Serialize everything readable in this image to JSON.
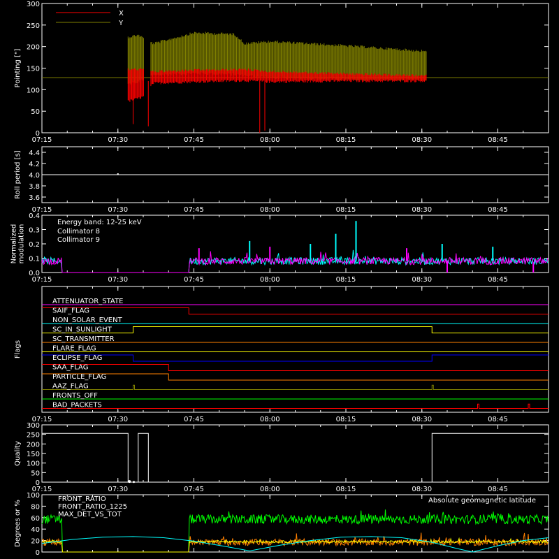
{
  "time_axis": {
    "tick_labels": [
      "07:15",
      "07:30",
      "07:45",
      "08:00",
      "08:15",
      "08:30",
      "08:45"
    ]
  },
  "chart_data": [
    {
      "type": "line",
      "name": "pointing",
      "ylabel": "Pointing [\"]",
      "ylim": [
        0,
        300
      ],
      "yticks": [
        "0",
        "50",
        "100",
        "150",
        "200",
        "250",
        "300"
      ],
      "legend": [
        {
          "label": "X",
          "color": "#ff0000"
        },
        {
          "label": "Y",
          "color": "#808000"
        }
      ],
      "legend_position": "top-left",
      "reference_line": {
        "value": 128,
        "color": "#808000"
      },
      "series": [
        {
          "name": "X",
          "color": "#ff0000",
          "envelope": [
            {
              "t": "07:32",
              "lo": 70,
              "hi": 150
            },
            {
              "t": "07:35",
              "lo": 80,
              "hi": 150
            },
            {
              "t": "07:37",
              "lo": 112,
              "hi": 145
            },
            {
              "t": "07:45",
              "lo": 115,
              "hi": 148
            },
            {
              "t": "07:55",
              "lo": 118,
              "hi": 150
            },
            {
              "t": "08:00",
              "lo": 115,
              "hi": 145
            },
            {
              "t": "08:15",
              "lo": 117,
              "hi": 140
            },
            {
              "t": "08:31",
              "lo": 117,
              "hi": 135
            }
          ],
          "spikes": [
            {
              "t": "07:33",
              "min": 20
            },
            {
              "t": "07:36",
              "min": 15
            },
            {
              "t": "07:58",
              "min": 0
            },
            {
              "t": "07:59",
              "min": 5
            }
          ]
        },
        {
          "name": "Y",
          "color": "#808000",
          "envelope": [
            {
              "t": "07:32",
              "lo": 110,
              "hi": 225
            },
            {
              "t": "07:34",
              "lo": 115,
              "hi": 230
            },
            {
              "t": "07:37",
              "lo": 130,
              "hi": 210
            },
            {
              "t": "07:45",
              "lo": 135,
              "hi": 235
            },
            {
              "t": "07:53",
              "lo": 132,
              "hi": 232
            },
            {
              "t": "07:55",
              "lo": 130,
              "hi": 210
            },
            {
              "t": "08:00",
              "lo": 125,
              "hi": 215
            },
            {
              "t": "08:15",
              "lo": 120,
              "hi": 205
            },
            {
              "t": "08:31",
              "lo": 120,
              "hi": 192
            }
          ]
        }
      ]
    },
    {
      "type": "line",
      "name": "roll-period",
      "ylabel": "Roll period [s]",
      "ylim": [
        3.5,
        4.5
      ],
      "yticks": [
        "3.6",
        "3.8",
        "4.0",
        "4.2",
        "4.4"
      ],
      "series": [
        {
          "name": "",
          "color": "#ffffff",
          "constant": 4.0
        }
      ]
    },
    {
      "type": "line",
      "name": "modulation",
      "ylabel_lines": [
        "Normalized",
        "modulation"
      ],
      "ylim": [
        0,
        0.4
      ],
      "yticks": [
        "0.0",
        "0.1",
        "0.2",
        "0.3",
        "0.4"
      ],
      "annotation": "Energy band: 12-25 keV",
      "legend": [
        {
          "label": "Collimator 8",
          "color": "#00ffff"
        },
        {
          "label": "Collimator 9",
          "color": "#ff00ff"
        }
      ],
      "series": [
        {
          "name": "Collimator 8",
          "color": "#00ffff",
          "baseline": 0.08,
          "active": [
            [
              "07:15",
              "07:19"
            ],
            [
              "07:44",
              "08:55"
            ]
          ]
        },
        {
          "name": "Collimator 9",
          "color": "#ff00ff",
          "baseline": 0.08,
          "active": [
            [
              "07:15",
              "07:19"
            ],
            [
              "07:44",
              "08:55"
            ]
          ]
        }
      ],
      "peaks": [
        {
          "t": "08:17",
          "v": 0.36,
          "color": "#00ffff"
        },
        {
          "t": "08:13",
          "v": 0.27,
          "color": "#00ffff"
        },
        {
          "t": "07:56",
          "v": 0.22,
          "color": "#00ffff"
        },
        {
          "t": "08:08",
          "v": 0.2,
          "color": "#00ffff"
        },
        {
          "t": "08:34",
          "v": 0.2,
          "color": "#00ffff"
        },
        {
          "t": "08:44",
          "v": 0.18,
          "color": "#00ffff"
        },
        {
          "t": "08:00",
          "v": 0.18,
          "color": "#ff00ff"
        },
        {
          "t": "08:27",
          "v": 0.17,
          "color": "#ff00ff"
        },
        {
          "t": "07:46",
          "v": 0.17,
          "color": "#ff00ff"
        }
      ]
    },
    {
      "type": "line",
      "name": "flags",
      "ylabel": "Flags",
      "series": [
        {
          "name": "ATTENUATOR_STATE",
          "color": "#ff00ff",
          "steps": []
        },
        {
          "name": "SAIF_FLAG",
          "color": "#ff0000",
          "steps": [
            [
              "07:15",
              "07:44",
              1
            ],
            [
              "07:44",
              "08:55",
              0
            ]
          ]
        },
        {
          "name": "NON_SOLAR_EVENT",
          "color": "#00ffff",
          "steps": []
        },
        {
          "name": "SC_IN_SUNLIGHT",
          "color": "#ffff00",
          "steps": [
            [
              "07:15",
              "07:33",
              0
            ],
            [
              "07:33",
              "08:32",
              1
            ],
            [
              "08:32",
              "08:55",
              0
            ]
          ]
        },
        {
          "name": "SC_TRANSMITTER",
          "color": "#ff8000",
          "steps": []
        },
        {
          "name": "FLARE_FLAG",
          "color": "#ffff00",
          "steps": []
        },
        {
          "name": "ECLIPSE_FLAG",
          "color": "#0000ff",
          "steps": [
            [
              "07:15",
              "07:33",
              1
            ],
            [
              "07:33",
              "08:32",
              0
            ],
            [
              "08:32",
              "08:55",
              1
            ]
          ]
        },
        {
          "name": "SAA_FLAG",
          "color": "#ff0000",
          "steps": [
            [
              "07:15",
              "07:40",
              1
            ],
            [
              "07:40",
              "08:55",
              0
            ]
          ]
        },
        {
          "name": "PARTICLE_FLAG",
          "color": "#ff8000",
          "steps": [
            [
              "07:15",
              "07:40",
              1
            ],
            [
              "07:40",
              "08:55",
              0
            ]
          ]
        },
        {
          "name": "AAZ_FLAG",
          "color": "#808000",
          "pulses": [
            "07:33",
            "08:32"
          ]
        },
        {
          "name": "FRONTS_OFF",
          "color": "#00ff00",
          "steps": []
        },
        {
          "name": "BAD_PACKETS",
          "color": "#ff0000",
          "pulses": [
            "08:41",
            "08:51"
          ]
        }
      ]
    },
    {
      "type": "line",
      "name": "quality",
      "ylabel": "Quality",
      "ylim": [
        0,
        300
      ],
      "yticks": [
        "0",
        "50",
        "100",
        "150",
        "200",
        "250",
        "300"
      ],
      "series": [
        {
          "name": "",
          "color": "#ffffff",
          "points": [
            [
              "07:15",
              255
            ],
            [
              "07:32",
              255
            ],
            [
              "07:32",
              0
            ],
            [
              "07:34",
              0
            ],
            [
              "07:34",
              255
            ],
            [
              "07:36",
              255
            ],
            [
              "07:36",
              0
            ],
            [
              "08:32",
              0
            ],
            [
              "08:32",
              255
            ],
            [
              "08:55",
              255
            ]
          ]
        }
      ]
    },
    {
      "type": "line",
      "name": "ratios",
      "ylabel": "Degrees or %",
      "ylim": [
        0,
        100
      ],
      "yticks": [
        "0",
        "20",
        "40",
        "60",
        "80",
        "100"
      ],
      "legend": [
        {
          "label": "FRONT_RATIO",
          "color": "#ffff00"
        },
        {
          "label": "FRONT_RATIO_1225",
          "color": "#00ff00"
        },
        {
          "label": "MAX_DET_VS_TOT",
          "color": "#ff8000"
        }
      ],
      "right_label": {
        "text": "Absolute geomagnetic latitude",
        "color": "#00ffff"
      },
      "series": [
        {
          "name": "FRONT_RATIO_1225",
          "color": "#00ff00",
          "mean": 57,
          "spread": 8,
          "active": [
            [
              "07:15",
              "07:19"
            ],
            [
              "07:44",
              "08:55"
            ]
          ]
        },
        {
          "name": "MAX_DET_VS_TOT",
          "color": "#ff8000",
          "mean": 17,
          "spread": 6,
          "active": [
            [
              "07:15",
              "07:19"
            ],
            [
              "07:44",
              "08:55"
            ]
          ]
        },
        {
          "name": "FRONT_RATIO",
          "color": "#ffff00",
          "mean": 18,
          "spread": 2,
          "active": [
            [
              "07:15",
              "07:19"
            ],
            [
              "07:44",
              "08:55"
            ]
          ]
        },
        {
          "name": "Absolute geomagnetic latitude",
          "color": "#00ffff",
          "points": [
            [
              "07:15",
              15
            ],
            [
              "07:21",
              22
            ],
            [
              "07:27",
              26
            ],
            [
              "07:33",
              27
            ],
            [
              "07:39",
              25
            ],
            [
              "07:45",
              19
            ],
            [
              "07:51",
              10
            ],
            [
              "07:56",
              2
            ],
            [
              "08:02",
              12
            ],
            [
              "08:08",
              20
            ],
            [
              "08:14",
              26
            ],
            [
              "08:20",
              27
            ],
            [
              "08:26",
              25
            ],
            [
              "08:32",
              17
            ],
            [
              "08:37",
              6
            ],
            [
              "08:40",
              0
            ],
            [
              "08:45",
              11
            ],
            [
              "08:50",
              20
            ],
            [
              "08:55",
              25
            ]
          ]
        }
      ]
    }
  ]
}
